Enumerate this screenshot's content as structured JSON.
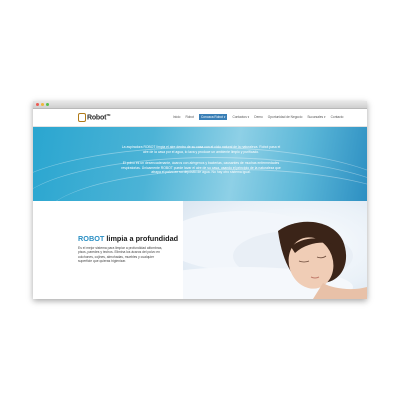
{
  "logo": {
    "brand": "Robot",
    "mark": "R",
    "trademark": "TM"
  },
  "nav": [
    {
      "label": "Inicio",
      "active": false
    },
    {
      "label": "Robot",
      "active": false
    },
    {
      "label": "Conozca Robot ▾",
      "active": true
    },
    {
      "label": "Contactos ▾",
      "active": false
    },
    {
      "label": "Demo",
      "active": false
    },
    {
      "label": "Oportunidad de Negocio",
      "active": false
    },
    {
      "label": "Sucursales ▾",
      "active": false
    },
    {
      "label": "Contacto",
      "active": false
    }
  ],
  "hero": {
    "p1": "La aspiradora ROBOT limpia el aire dentro de su casa con el ciclo natural de la naturaleza. Robot pasa el aire de la casa por el agua, lo lava y produce un ambiente limpio y purificado.",
    "p2": "El polvo es un desencadenante, ácaros con alérgenos y bacterias, causantes de muchas enfermedades respiratorias. Únicamente ROBOT puede lavar el aire de su casa, usando el principio de la naturaleza que atrapa el polvo en su depósito de agua. No hay otro sistema igual."
  },
  "section": {
    "title_brand": "ROBOT",
    "title_rest": "limpia a profundidad",
    "text": "Es el mejor sistema para limpiar a profundidad alfombras, pisos, paredes y techos. Elimina los ácaros del polvo en colchones, cojines, almohadas, muebles y cualquier superficie que quieras higienizar."
  },
  "colors": {
    "accent": "#2a8fc4",
    "nav_active": "#3a7fb6",
    "logo_accent": "#b07a18"
  }
}
